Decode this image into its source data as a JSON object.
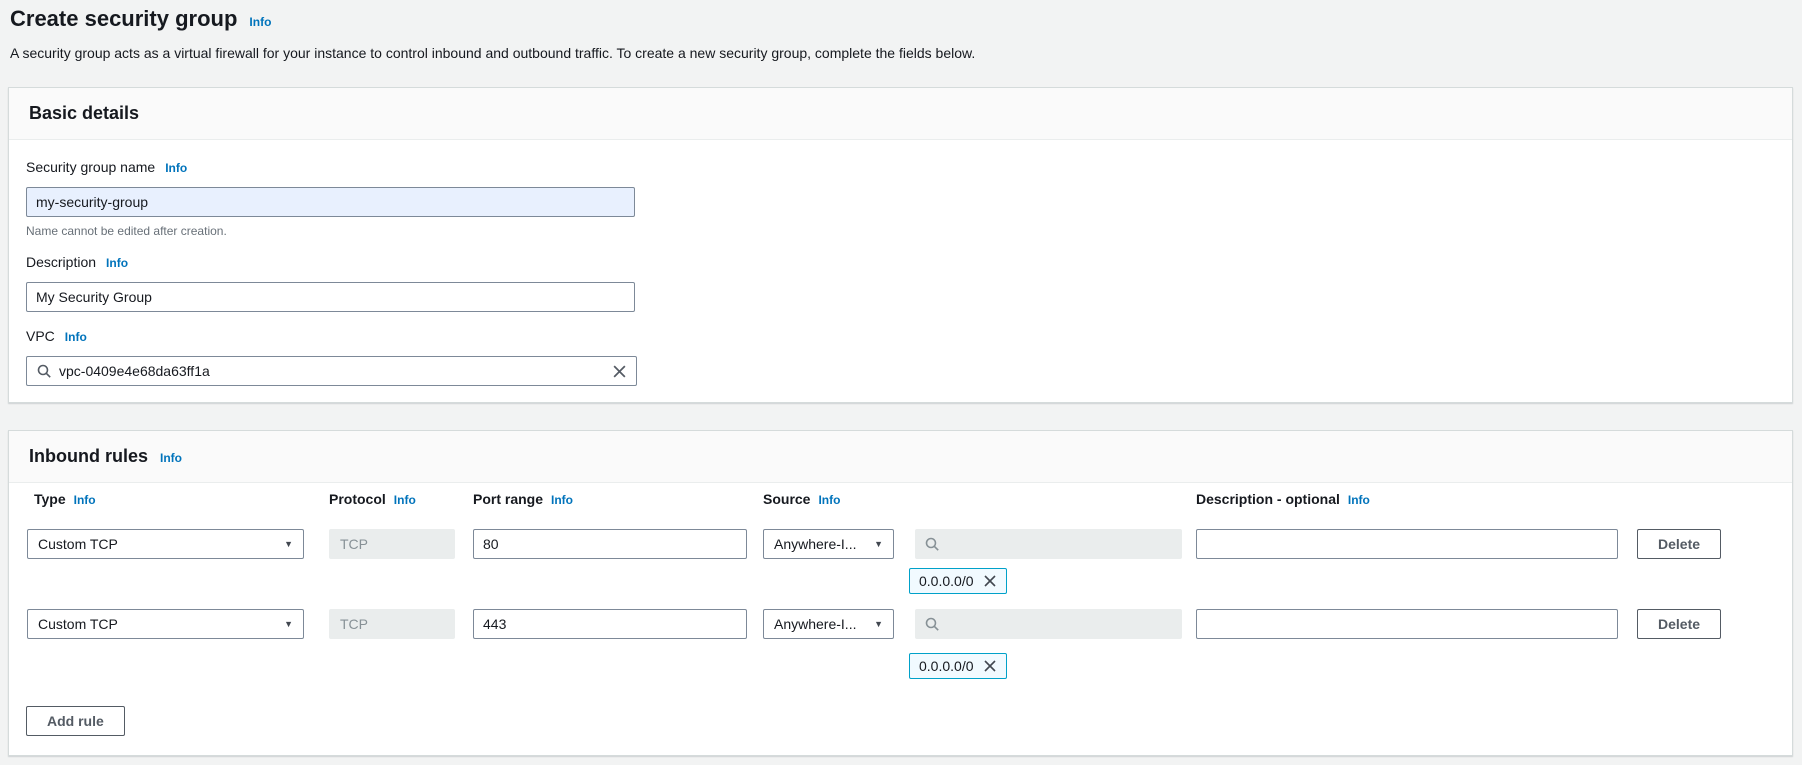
{
  "labels": {
    "info": "Info"
  },
  "icons": {
    "caret_down": "▼"
  },
  "colors": {
    "info_link": "#0073bb",
    "chip_border": "#00a1c9",
    "chip_bg": "#f1faff",
    "autofill_bg": "#e8f0fe",
    "disabled_bg": "#eaeded",
    "button_border": "#545b64",
    "page_bg": "#f2f3f3"
  },
  "page": {
    "title": "Create security group",
    "subtitle": "A security group acts as a virtual firewall for your instance to control inbound and outbound traffic. To create a new security group, complete the fields below."
  },
  "basic_details": {
    "title": "Basic details",
    "name_label": "Security group name",
    "name_value": "my-security-group",
    "name_helper": "Name cannot be edited after creation.",
    "description_label": "Description",
    "description_value": "My Security Group",
    "vpc_label": "VPC",
    "vpc_value": "vpc-0409e4e68da63ff1a"
  },
  "inbound_rules": {
    "title": "Inbound rules",
    "columns": {
      "type": "Type",
      "protocol": "Protocol",
      "port_range": "Port range",
      "source": "Source",
      "description": "Description - optional"
    },
    "rows": [
      {
        "type": "Custom TCP",
        "protocol": "TCP",
        "port": "80",
        "source": "Anywhere-I...",
        "chip": "0.0.0.0/0",
        "description": ""
      },
      {
        "type": "Custom TCP",
        "protocol": "TCP",
        "port": "443",
        "source": "Anywhere-I...",
        "chip": "0.0.0.0/0",
        "description": ""
      }
    ],
    "delete_label": "Delete",
    "add_rule_label": "Add rule"
  }
}
